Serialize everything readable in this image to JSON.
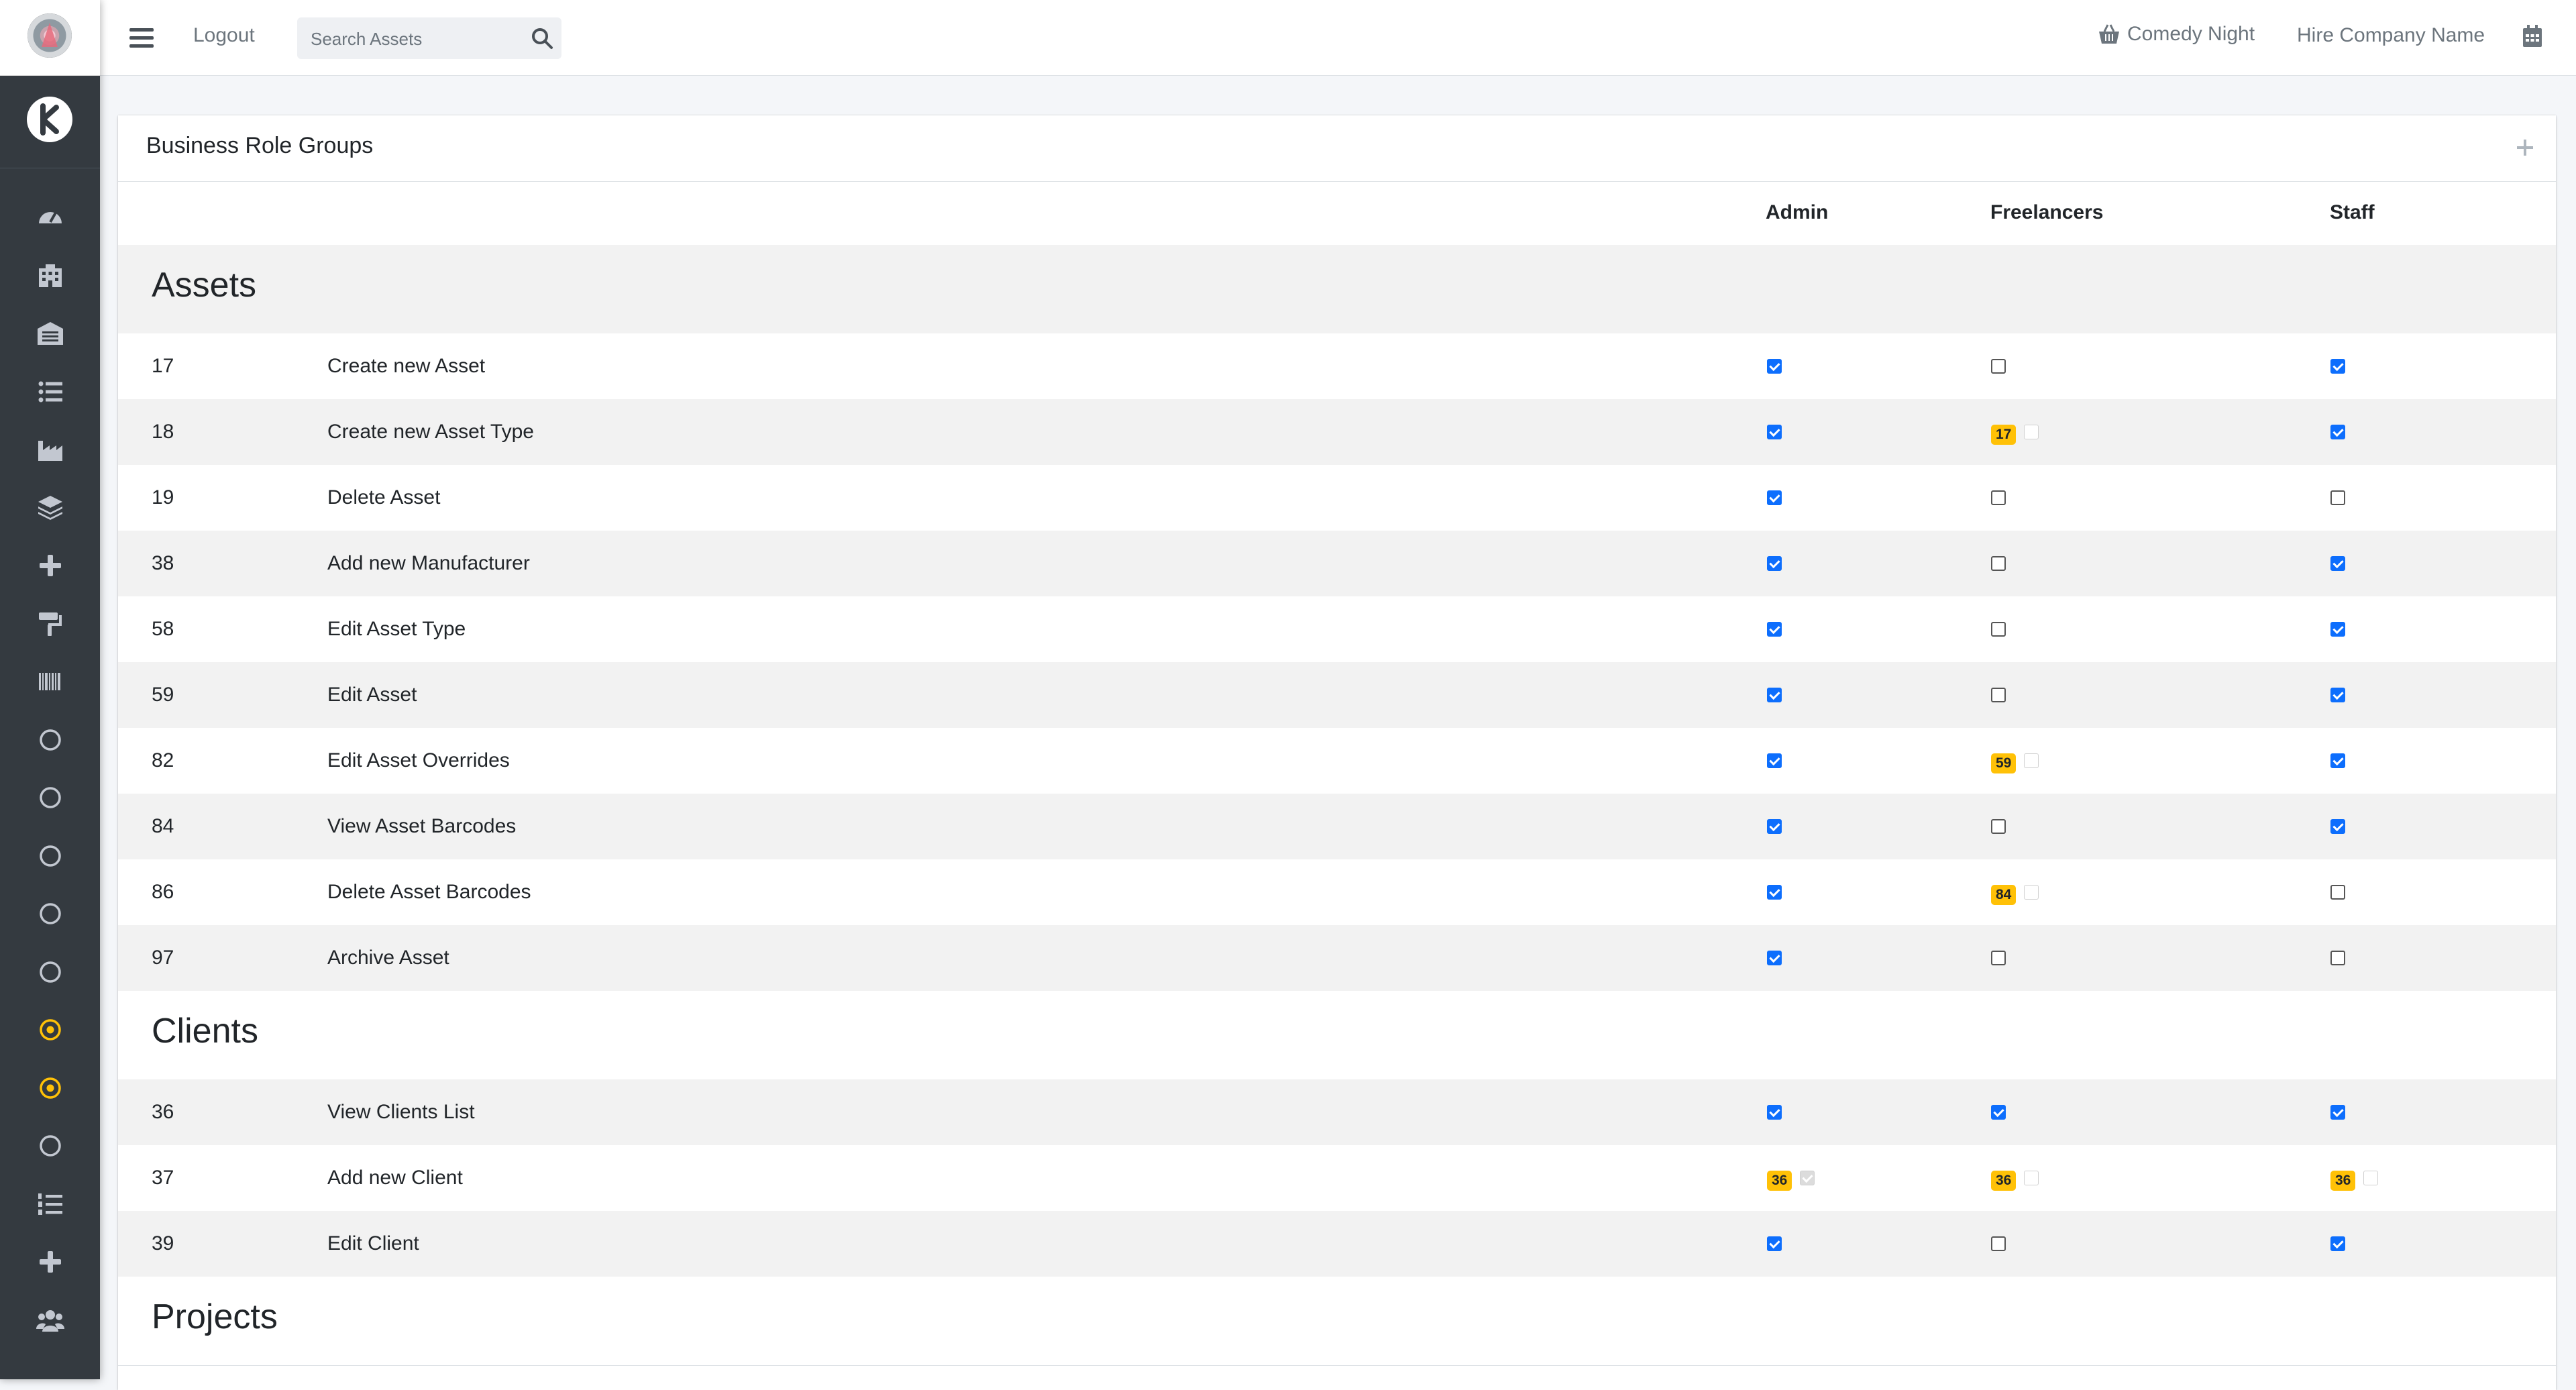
{
  "topbar": {
    "logout": "Logout",
    "search_placeholder": "Search Assets",
    "project": "Comedy Night",
    "company": "Hire Company Name"
  },
  "sidebar": {
    "icons": [
      "tachometer-icon",
      "building-icon",
      "warehouse-icon",
      "list-icon",
      "industry-icon",
      "layers-icon",
      "plus-icon",
      "paint-roller-icon",
      "barcode-icon",
      "circle-icon",
      "circle-icon",
      "circle-icon",
      "circle-icon",
      "circle-icon",
      "dot-circle-icon",
      "dot-circle-icon",
      "circle-icon",
      "list-ol-icon",
      "plus-icon",
      "users-icon"
    ]
  },
  "card": {
    "title": "Business Role Groups",
    "columns": [
      "Admin",
      "Freelancers",
      "Staff"
    ]
  },
  "sections": [
    {
      "title": "Assets",
      "rows": [
        {
          "id": "17",
          "name": "Create new Asset",
          "cells": [
            {
              "state": "checked"
            },
            {
              "state": "unchecked"
            },
            {
              "state": "checked"
            }
          ]
        },
        {
          "id": "18",
          "name": "Create new Asset Type",
          "cells": [
            {
              "state": "checked"
            },
            {
              "state": "disabled-unchecked",
              "badge": "17"
            },
            {
              "state": "checked"
            }
          ]
        },
        {
          "id": "19",
          "name": "Delete Asset",
          "cells": [
            {
              "state": "checked"
            },
            {
              "state": "unchecked"
            },
            {
              "state": "unchecked"
            }
          ]
        },
        {
          "id": "38",
          "name": "Add new Manufacturer",
          "cells": [
            {
              "state": "checked"
            },
            {
              "state": "unchecked"
            },
            {
              "state": "checked"
            }
          ]
        },
        {
          "id": "58",
          "name": "Edit Asset Type",
          "cells": [
            {
              "state": "checked"
            },
            {
              "state": "unchecked"
            },
            {
              "state": "checked"
            }
          ]
        },
        {
          "id": "59",
          "name": "Edit Asset",
          "cells": [
            {
              "state": "checked"
            },
            {
              "state": "unchecked"
            },
            {
              "state": "checked"
            }
          ]
        },
        {
          "id": "82",
          "name": "Edit Asset Overrides",
          "cells": [
            {
              "state": "checked"
            },
            {
              "state": "disabled-unchecked",
              "badge": "59"
            },
            {
              "state": "checked"
            }
          ]
        },
        {
          "id": "84",
          "name": "View Asset Barcodes",
          "cells": [
            {
              "state": "checked"
            },
            {
              "state": "unchecked"
            },
            {
              "state": "checked"
            }
          ]
        },
        {
          "id": "86",
          "name": "Delete Asset Barcodes",
          "cells": [
            {
              "state": "checked"
            },
            {
              "state": "disabled-unchecked",
              "badge": "84"
            },
            {
              "state": "unchecked"
            }
          ]
        },
        {
          "id": "97",
          "name": "Archive Asset",
          "cells": [
            {
              "state": "checked"
            },
            {
              "state": "unchecked"
            },
            {
              "state": "unchecked"
            }
          ]
        }
      ]
    },
    {
      "title": "Clients",
      "rows": [
        {
          "id": "36",
          "name": "View Clients List",
          "cells": [
            {
              "state": "checked"
            },
            {
              "state": "checked"
            },
            {
              "state": "checked"
            }
          ]
        },
        {
          "id": "37",
          "name": "Add new Client",
          "cells": [
            {
              "state": "disabled-checked",
              "badge": "36"
            },
            {
              "state": "disabled-unchecked",
              "badge": "36"
            },
            {
              "state": "disabled-unchecked",
              "badge": "36"
            }
          ]
        },
        {
          "id": "39",
          "name": "Edit Client",
          "cells": [
            {
              "state": "checked"
            },
            {
              "state": "unchecked"
            },
            {
              "state": "checked"
            }
          ]
        }
      ]
    },
    {
      "title": "Projects",
      "rows": []
    }
  ],
  "colors": {
    "sidebar_bg": "#343a40",
    "checkbox_checked": "#0d6efd",
    "badge_bg": "#ffc107",
    "active_nav_icon": "#ffc107",
    "stripe_row": "#f2f2f2"
  }
}
